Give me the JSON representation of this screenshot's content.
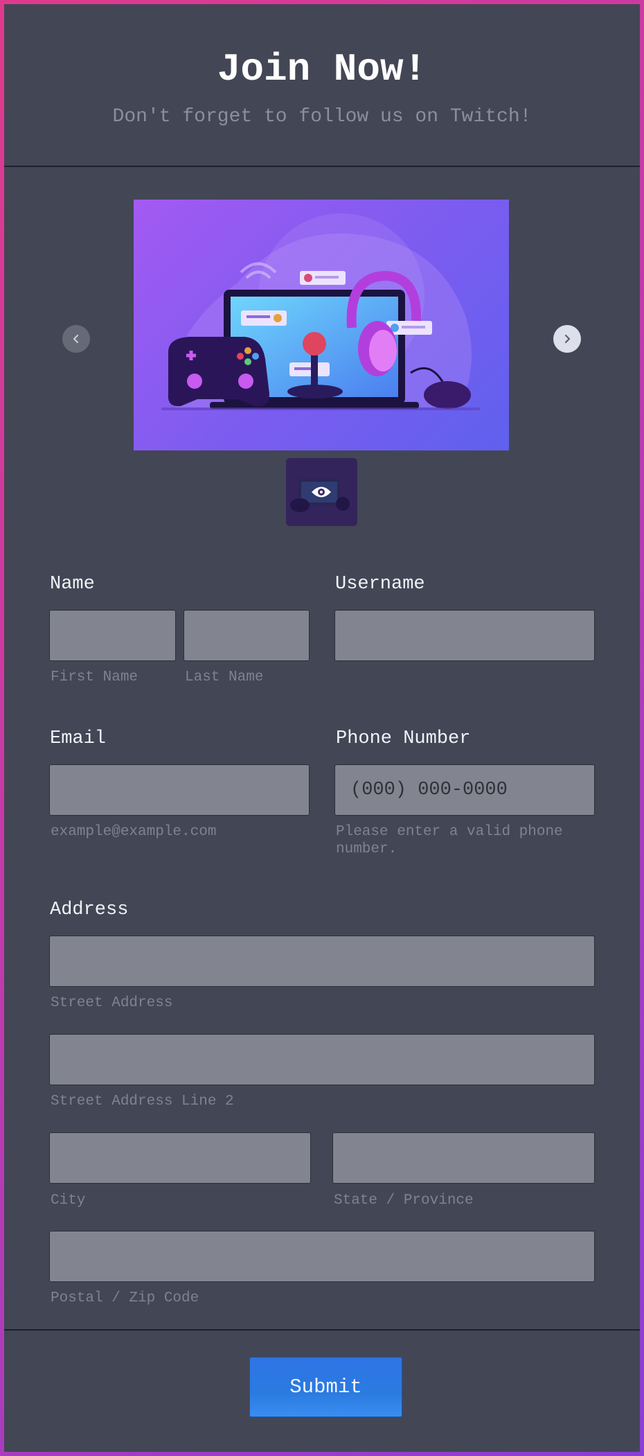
{
  "header": {
    "title": "Join Now!",
    "subtitle": "Don't forget to follow us on Twitch!"
  },
  "carousel": {
    "prev_icon": "chevron-left-icon",
    "next_icon": "chevron-right-icon",
    "thumbnail_icon": "eye-icon"
  },
  "form": {
    "name": {
      "label": "Name",
      "first_sublabel": "First Name",
      "last_sublabel": "Last Name",
      "first_value": "",
      "last_value": ""
    },
    "username": {
      "label": "Username",
      "value": ""
    },
    "email": {
      "label": "Email",
      "sublabel": "example@example.com",
      "value": ""
    },
    "phone": {
      "label": "Phone Number",
      "placeholder": "(000) 000-0000",
      "sublabel": "Please enter a valid phone number.",
      "value": ""
    },
    "address": {
      "label": "Address",
      "street_sublabel": "Street Address",
      "street2_sublabel": "Street Address Line 2",
      "city_sublabel": "City",
      "state_sublabel": "State / Province",
      "postal_sublabel": "Postal / Zip Code"
    },
    "submit_label": "Submit"
  },
  "colors": {
    "background": "#434655",
    "field": "#82858f",
    "submit": "#2a7be0",
    "border_gradient_start": "#e03a8c",
    "border_gradient_end": "#8a3ed6"
  }
}
